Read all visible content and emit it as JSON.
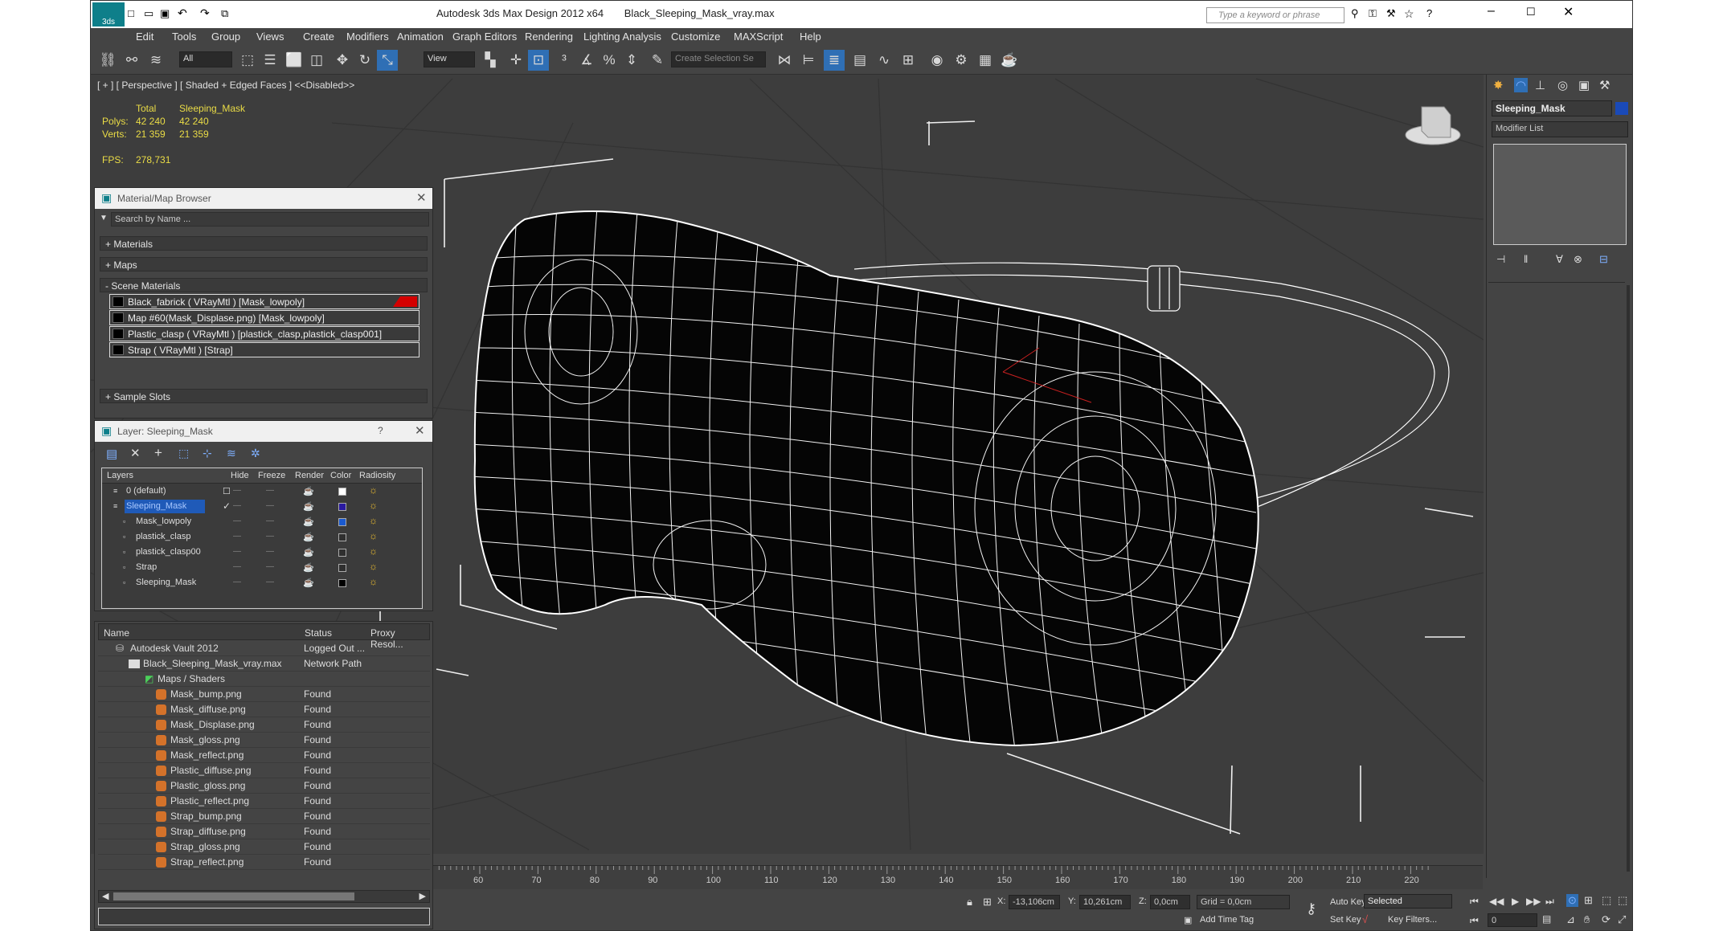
{
  "app": {
    "title": "Autodesk 3ds Max Design 2012 x64",
    "file": "Black_Sleeping_Mask_vray.max",
    "search_placeholder": "Type a keyword or phrase"
  },
  "menu": [
    "Edit",
    "Tools",
    "Group",
    "Views",
    "Create",
    "Modifiers",
    "Animation",
    "Graph Editors",
    "Rendering",
    "Lighting Analysis",
    "Customize",
    "MAXScript",
    "Help"
  ],
  "toolbar": {
    "filter": "All",
    "coord": "View",
    "selection_set": "Create Selection Se"
  },
  "viewport": {
    "label": "[ + ] [ Perspective ] [ Shaded + Edged Faces ] <<Disabled>>",
    "stats": {
      "col_total": "Total",
      "col_obj": "Sleeping_Mask",
      "polys_label": "Polys:",
      "polys_total": "42 240",
      "polys_obj": "42 240",
      "verts_label": "Verts:",
      "verts_total": "21 359",
      "verts_obj": "21 359",
      "fps_label": "FPS:",
      "fps": "278,731"
    }
  },
  "mat_browser": {
    "title": "Material/Map Browser",
    "search": "Search by Name ...",
    "groups": {
      "materials": "+ Materials",
      "maps": "+ Maps",
      "scene": "- Scene Materials",
      "sample": "+ Sample Slots"
    },
    "items": [
      "Black_fabrick  ( VRayMtl ) [Mask_lowpoly]",
      "Map #60(Mask_Displase.png) [Mask_lowpoly]",
      "Plastic_clasp  ( VRayMtl ) [plastick_clasp,plastick_clasp001]",
      "Strap  ( VRayMtl ) [Strap]"
    ]
  },
  "layer_panel": {
    "title": "Layer: Sleeping_Mask",
    "help": "?",
    "headers": [
      "Layers",
      "Hide",
      "Freeze",
      "Render",
      "Color",
      "Radiosity"
    ],
    "rows": [
      {
        "name": "0 (default)",
        "color": "#ffffff"
      },
      {
        "name": "Sleeping_Mask",
        "color": "#2a1aa0"
      },
      {
        "name": "Mask_lowpoly",
        "color": "#1a5ad0"
      },
      {
        "name": "plastick_clasp",
        "color": "#2f2f2f"
      },
      {
        "name": "plastick_clasp00",
        "color": "#2f2f2f"
      },
      {
        "name": "Strap",
        "color": "#2f2f2f"
      },
      {
        "name": "Sleeping_Mask",
        "color": "#000000"
      }
    ]
  },
  "asset_tracking": {
    "headers": [
      "Name",
      "Status",
      "Proxy Resol..."
    ],
    "vault": {
      "name": "Autodesk Vault 2012",
      "status": "Logged Out ..."
    },
    "file": {
      "name": "Black_Sleeping_Mask_vray.max",
      "status": "Network Path"
    },
    "folder": "Maps / Shaders",
    "files": [
      {
        "name": "Mask_bump.png",
        "status": "Found"
      },
      {
        "name": "Mask_diffuse.png",
        "status": "Found"
      },
      {
        "name": "Mask_Displase.png",
        "status": "Found"
      },
      {
        "name": "Mask_gloss.png",
        "status": "Found"
      },
      {
        "name": "Mask_reflect.png",
        "status": "Found"
      },
      {
        "name": "Plastic_diffuse.png",
        "status": "Found"
      },
      {
        "name": "Plastic_gloss.png",
        "status": "Found"
      },
      {
        "name": "Plastic_reflect.png",
        "status": "Found"
      },
      {
        "name": "Strap_bump.png",
        "status": "Found"
      },
      {
        "name": "Strap_diffuse.png",
        "status": "Found"
      },
      {
        "name": "Strap_gloss.png",
        "status": "Found"
      },
      {
        "name": "Strap_reflect.png",
        "status": "Found"
      }
    ]
  },
  "command_panel": {
    "object_name": "Sleeping_Mask",
    "modifier_list": "Modifier List"
  },
  "timeline": {
    "ticks": [
      "60",
      "70",
      "80",
      "90",
      "100",
      "110",
      "120",
      "130",
      "140",
      "150",
      "160",
      "170",
      "180",
      "190",
      "200",
      "210",
      "220"
    ]
  },
  "status": {
    "x_label": "X:",
    "x": "-13,106cm",
    "y_label": "Y:",
    "y": "10,261cm",
    "z_label": "Z:",
    "z": "0,0cm",
    "grid": "Grid = 0,0cm",
    "add_time_tag": "Add Time Tag",
    "auto_key": "Auto Key",
    "selected": "Selected",
    "set_key": "Set Key",
    "key_filters": "Key Filters...",
    "frame": "0"
  },
  "colors": {
    "ui_bg": "#444444",
    "viewport_bg": "#3d3d3d",
    "wire": "#ffffff",
    "accent_blue": "#1f5ab8",
    "mat_red": "#d40000"
  }
}
